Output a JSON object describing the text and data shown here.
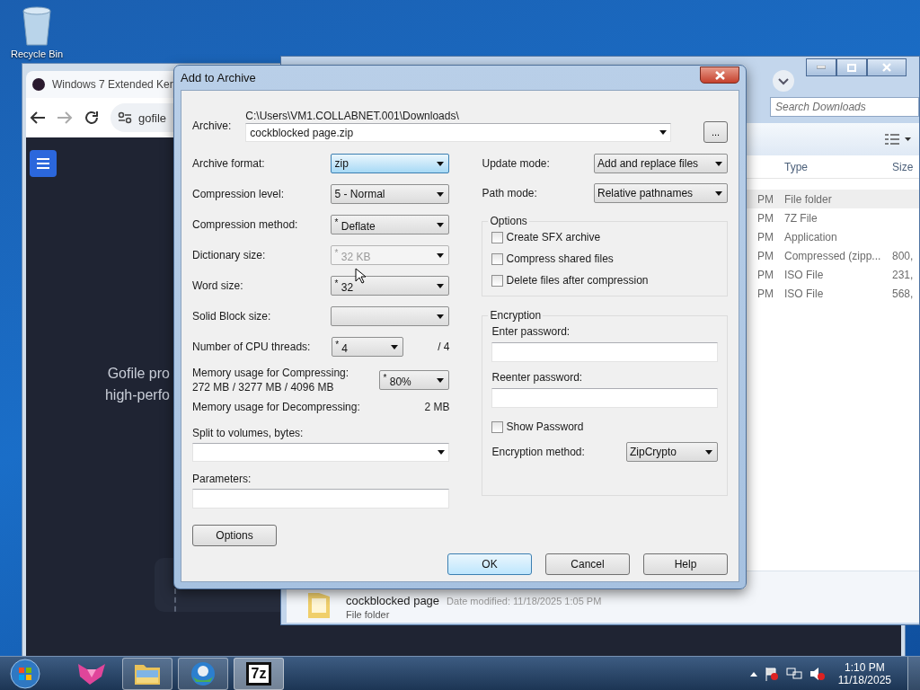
{
  "desktop_icons": [
    {
      "label": "Recycle Bin"
    }
  ],
  "browser": {
    "tab_title": "Windows 7 Extended Ker",
    "address": "gofile",
    "page_lines": [
      "Gofile pro",
      "high-perfo"
    ]
  },
  "explorer": {
    "search": {
      "placeholder": "Search Downloads"
    },
    "columns": [
      "Type",
      "Size"
    ],
    "rows": [
      {
        "column_1": "PM",
        "type": "File folder",
        "selected": true
      },
      {
        "column_1": "PM",
        "type": "7Z File",
        "selected": false
      },
      {
        "column_1": "PM",
        "type": "Application",
        "selected": false
      },
      {
        "column_1": "PM",
        "type": "Compressed (zipp...",
        "size": "800,",
        "selected": false
      },
      {
        "column_1": "PM",
        "type": "ISO File",
        "size": "231,",
        "selected": false
      },
      {
        "column_1": "PM",
        "type": "ISO File",
        "size": "568,",
        "selected": false
      }
    ],
    "details": {
      "name": "cockblocked page",
      "modified": "Date modified: 11/18/2025 1:05 PM",
      "type": "File folder"
    }
  },
  "dialog": {
    "title": "Add to Archive",
    "archive": {
      "label": "Archive:",
      "path": "C:\\Users\\VM1.COLLABNET.001\\Downloads\\",
      "value": "cockblocked page.zip",
      "browse": "..."
    },
    "settings": [
      {
        "kind": "select",
        "label": "Archive format:",
        "value": "zip",
        "focused": true,
        "disabled": false
      },
      {
        "kind": "select",
        "label": "Compression level:",
        "value": "5 - Normal",
        "focused": false,
        "disabled": false
      },
      {
        "kind": "select",
        "label": "Compression method:",
        "value": "$^{*}$ Deflate",
        "focused": false,
        "disabled": false
      },
      {
        "kind": "select",
        "label": "Dictionary size:",
        "value": "$^{*}$ 32 KB",
        "focused": false,
        "disabled": true
      },
      {
        "kind": "select",
        "label": "Word size:",
        "value": "$^{*}$ 32",
        "focused": false,
        "disabled": false
      },
      {
        "kind": "select",
        "label": "Solid Block size:",
        "focused": false,
        "disabled": false
      },
      {
        "kind": "select_short",
        "label": "Number of CPU threads:",
        "value": "$^{*}$ 4",
        "suffix": "/ 4",
        "focused": false,
        "disabled": false
      },
      {
        "kind": "memory",
        "label": "Memory usage for Compressing:",
        "detail": "272 MB / 3277 MB / 4096 MB",
        "value": "$^{*}$ 80%",
        "focused": false,
        "disabled": false
      },
      {
        "kind": "info",
        "label": "Memory usage for Decompressing:",
        "value": "2 MB"
      },
      {
        "kind": "combo",
        "label": "Split to volumes, bytes:"
      },
      {
        "kind": "text",
        "label": "Parameters:"
      }
    ],
    "options_button": "Options",
    "modes": [
      {
        "label": "Update mode:",
        "value": "Add and replace files"
      },
      {
        "label": "Path mode:",
        "value": "Relative pathnames"
      }
    ],
    "options_group": {
      "title": "Options",
      "checkboxes": [
        {
          "label": "Create SFX archive",
          "checked": false
        },
        {
          "label": "Compress shared files",
          "checked": false
        },
        {
          "label": "Delete files after compression",
          "checked": false
        }
      ]
    },
    "encryption": {
      "title": "Encryption",
      "fields": [
        {
          "label": "Enter password:"
        },
        {
          "label": "Reenter password:"
        }
      ],
      "show_password": {
        "label": "Show Password",
        "checked": false
      },
      "method": {
        "label": "Encryption method:",
        "value": "ZipCrypto"
      }
    },
    "buttons": [
      {
        "label": "OK",
        "default": true
      },
      {
        "label": "Cancel",
        "default": false
      },
      {
        "label": "Help",
        "default": false
      }
    ]
  },
  "taskbar": {
    "items": [
      {
        "kind": "pink_app",
        "running": false,
        "selected": false
      },
      {
        "kind": "explorer",
        "running": true,
        "selected": false
      },
      {
        "kind": "browser",
        "running": true,
        "selected": false
      },
      {
        "kind": "sevenzip",
        "label": "7z",
        "running": true,
        "selected": true
      }
    ],
    "time": "1:10 PM",
    "date": "11/18/2025"
  }
}
